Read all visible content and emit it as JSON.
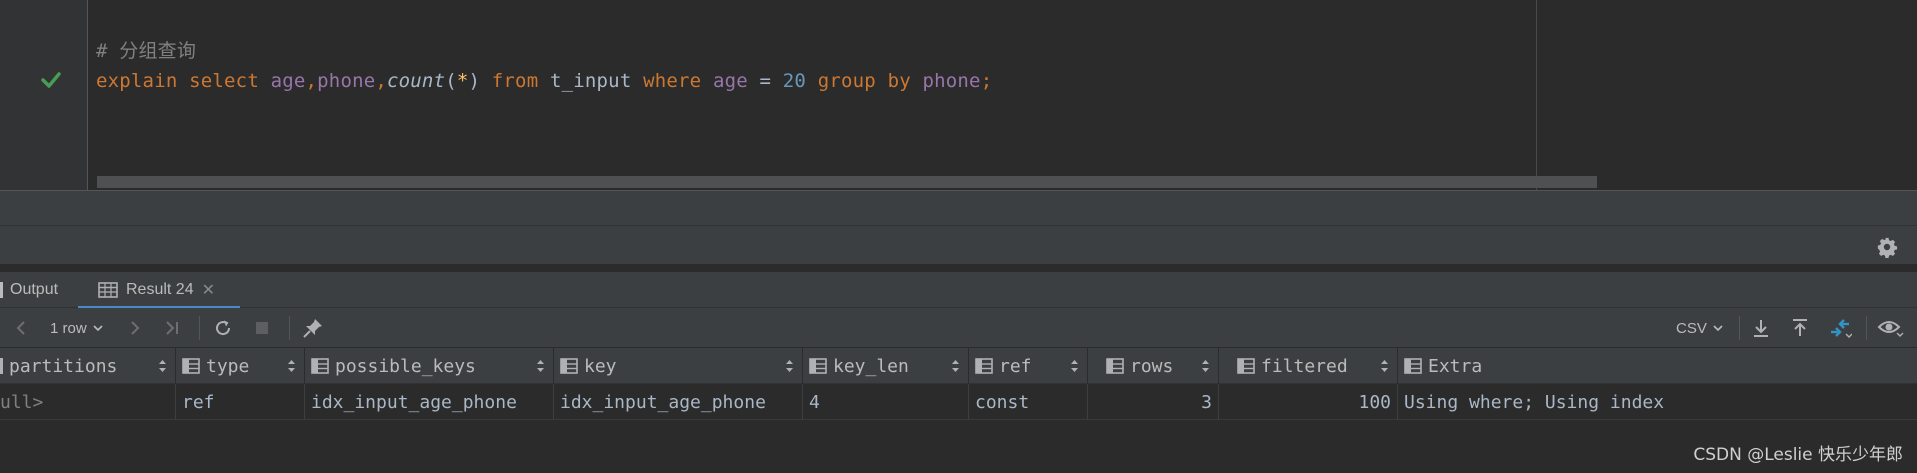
{
  "editor": {
    "comment": "# 分组查询",
    "sql": {
      "explain": "explain",
      "select": "select",
      "col_age": "age",
      "comma1": ",",
      "col_phone": "phone",
      "comma2": ",",
      "fn_count": "count",
      "lparen": "(",
      "star": "*",
      "rparen": ")",
      "from": "from",
      "table": "t_input",
      "where": "where",
      "col_age2": "age",
      "eq": "=",
      "value": "20",
      "group": "group",
      "by": "by",
      "col_phone2": "phone",
      "semicolon": ";"
    },
    "gutter_status_icon": "check-icon",
    "colors": {
      "keyword": "#cc7832",
      "column": "#9876aa",
      "number": "#6897bb",
      "comment": "#808080",
      "check": "#499c54"
    }
  },
  "tabs": [
    {
      "label": "Output",
      "active": false
    },
    {
      "label": "Result 24",
      "active": true
    }
  ],
  "toolbar": {
    "row_count": "1 row",
    "export_format": "CSV"
  },
  "grid": {
    "columns": [
      "partitions",
      "type",
      "possible_keys",
      "key",
      "key_len",
      "ref",
      "rows",
      "filtered",
      "Extra"
    ],
    "row": [
      "ull>",
      "ref",
      "idx_input_age_phone",
      "idx_input_age_phone",
      "4",
      "const",
      "3",
      "100",
      "Using where; Using index"
    ]
  },
  "watermark": "CSDN @Leslie 快乐少年郎",
  "accent_color": "#4a88c7"
}
